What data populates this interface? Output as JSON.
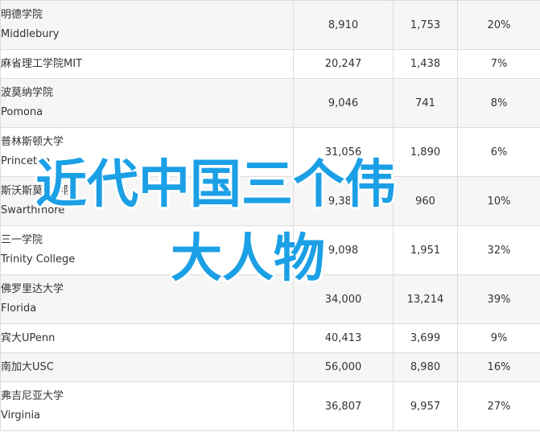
{
  "rows": [
    {
      "cn": "明德学院",
      "en": "Middlebury",
      "v1": "8,910",
      "v2": "1,753",
      "pct": "20%"
    },
    {
      "cn": "麻省理工学院MIT",
      "en": "",
      "v1": "20,247",
      "v2": "1,438",
      "pct": "7%"
    },
    {
      "cn": "波莫纳学院",
      "en": "Pomona",
      "v1": "9,046",
      "v2": "741",
      "pct": "8%"
    },
    {
      "cn": "普林斯顿大学",
      "en": "Princeton",
      "v1": "31,056",
      "v2": "1,890",
      "pct": "6%"
    },
    {
      "cn": "斯沃斯莫尔学院",
      "en": "Swarthmore",
      "v1": "9,383",
      "v2": "960",
      "pct": "10%"
    },
    {
      "cn": "三一学院",
      "en": "Trinity College",
      "v1": "9,098",
      "v2": "1,951",
      "pct": "32%"
    },
    {
      "cn": "佛罗里达大学",
      "en": "Florida",
      "v1": "34,000",
      "v2": "13,214",
      "pct": "39%"
    },
    {
      "cn": "宾大UPenn",
      "en": "",
      "v1": "40,413",
      "v2": "3,699",
      "pct": "9%"
    },
    {
      "cn": "南加大USC",
      "en": "",
      "v1": "56,000",
      "v2": "8,980",
      "pct": "16%"
    },
    {
      "cn": "弗吉尼亚大学",
      "en": "Virginia",
      "v1": "36,807",
      "v2": "9,957",
      "pct": "27%"
    }
  ],
  "overlay": {
    "line1": "近代中国三个伟",
    "line2": "大人物",
    "color": "#1ba0e6"
  }
}
